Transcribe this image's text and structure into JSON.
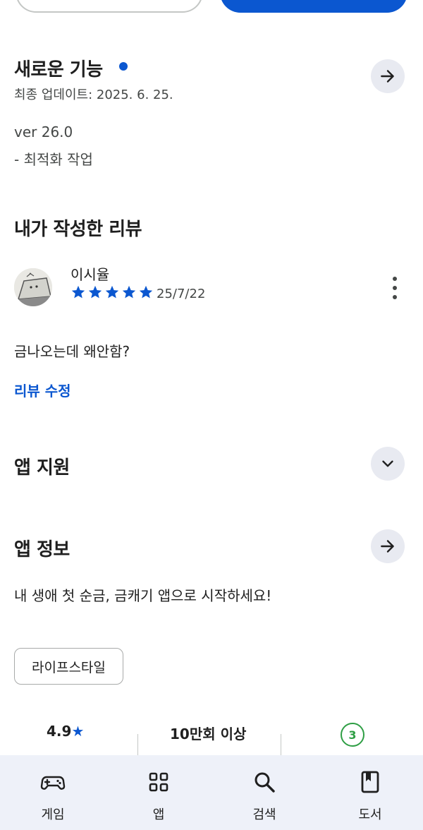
{
  "whats_new": {
    "title": "새로운 기능",
    "updated": "최종 업데이트: 2025. 6. 25.",
    "version": "ver 26.0",
    "note": "- 최적화 작업"
  },
  "my_review": {
    "title": "내가 작성한 리뷰",
    "reviewer": "이시율",
    "rating": 5,
    "date": "25/7/22",
    "body": "금나오는데 왜안함?",
    "edit_label": "리뷰 수정"
  },
  "app_support": {
    "title": "앱 지원"
  },
  "app_info": {
    "title": "앱 정보",
    "description": "내 생애 첫 순금, 금캐기 앱으로 시작하세요!",
    "category_chip": "라이프스타일"
  },
  "stats": {
    "rating": "4.9",
    "downloads": "10만회 이상",
    "age_rating": "3"
  },
  "bottom_nav": {
    "items": [
      {
        "label": "게임",
        "icon": "gamepad-icon"
      },
      {
        "label": "앱",
        "icon": "apps-grid-icon"
      },
      {
        "label": "검색",
        "icon": "search-icon"
      },
      {
        "label": "도서",
        "icon": "book-icon"
      }
    ]
  },
  "colors": {
    "accent": "#0b57d0",
    "star": "#0b57d0",
    "age_badge": "#2e9e44",
    "nav_bg": "#eef1f9"
  }
}
